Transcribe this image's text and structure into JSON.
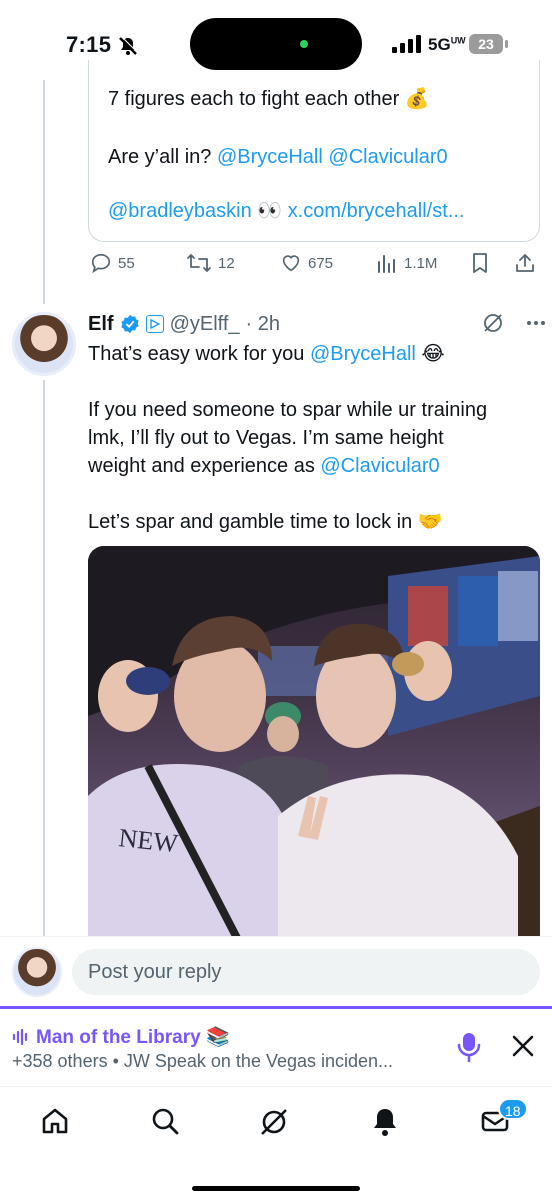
{
  "status_bar": {
    "time": "7:15",
    "network": "5G",
    "network_sup": "UW",
    "battery": "23"
  },
  "quoted": {
    "line1": "7 figures each to fight each other 💰",
    "line2_text": "Are y’all in? ",
    "mention1": "@BryceHall",
    "mention2": "@Clavicular0",
    "mention3": "@bradleybaskin",
    "eyes": " 👀 ",
    "link": "x.com/brycehall/st..."
  },
  "actions": {
    "replies": "55",
    "reposts": "12",
    "likes": "675",
    "views": "1.1M"
  },
  "reply": {
    "name": "Elf",
    "handle": "@yElff_",
    "time": "· 2h",
    "l1_text": "That’s easy work for you ",
    "l1_mention": "@BryceHall",
    "l1_emoji": " 😂",
    "l2": "If you need someone to spar while ur training",
    "l3": "lmk, I’ll fly out to Vegas. I’m same height",
    "l4_text": "weight and experience  as ",
    "l4_mention": "@Clavicular0",
    "l5": "Let’s spar and gamble time to lock in 🤝"
  },
  "composer": {
    "placeholder": "Post your reply"
  },
  "space": {
    "title": "Man of the Library 📚",
    "subtitle": "+358 others • JW Speak on the Vegas inciden..."
  },
  "nav": {
    "messages_badge": "18"
  },
  "colors": {
    "link": "#1d9bf0",
    "spaces": "#7856ff",
    "text": "#0f1419",
    "muted": "#536471"
  }
}
